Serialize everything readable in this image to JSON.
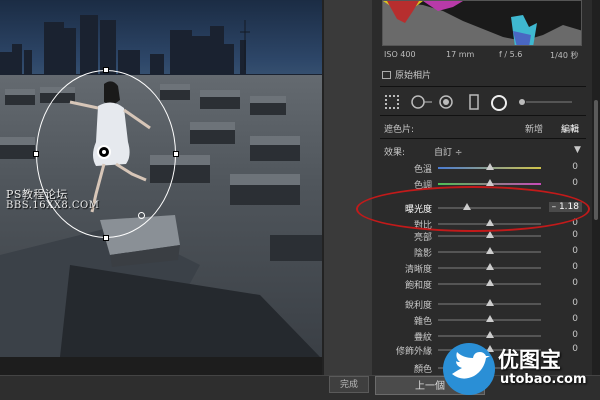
{
  "exif": {
    "iso": "ISO 400",
    "focal": "17 mm",
    "aperture": "f / 5.6",
    "shutter": "1/40 秒"
  },
  "original_photo_label": "原始相片",
  "mask": {
    "label": "遮色片:",
    "new_label": "新增",
    "edit_label": "編輯"
  },
  "effect": {
    "label": "效果:",
    "value": "自訂 ÷",
    "collapse": "▼"
  },
  "sliders": [
    {
      "name": "色溫",
      "value": "0",
      "level": 0.5
    },
    {
      "name": "色調",
      "value": "0",
      "level": 0.5
    },
    {
      "name": "曝光度",
      "value": "– 1.18",
      "level": 0.28,
      "highlighted": true
    },
    {
      "name": "對比",
      "value": "0",
      "level": 0.5
    },
    {
      "name": "亮部",
      "value": "0",
      "level": 0.5
    },
    {
      "name": "陰影",
      "value": "0",
      "level": 0.5
    },
    {
      "name": "清晰度",
      "value": "0",
      "level": 0.5
    },
    {
      "name": "飽和度",
      "value": "0",
      "level": 0.5
    },
    {
      "name": "銳利度",
      "value": "0",
      "level": 0.5
    },
    {
      "name": "雜色",
      "value": "0",
      "level": 0.5
    },
    {
      "name": "疊紋",
      "value": "0",
      "level": 0.5
    },
    {
      "name": "修飾外緣",
      "value": "0",
      "level": 0.5
    },
    {
      "name": "顏色",
      "value": "",
      "level": 0.5
    }
  ],
  "watermark": {
    "line1": "PS教程论坛",
    "line2": "BBS.16XX8.COM"
  },
  "buttons": {
    "done": "完成",
    "previous": "上一個"
  },
  "logo": {
    "line1": "优图宝",
    "line2": "utobao.com"
  },
  "colors": {
    "annotation_red": "#c21a1a",
    "panel_bg": "#2b2b2b",
    "logo_blue": "#2a8fd6"
  }
}
